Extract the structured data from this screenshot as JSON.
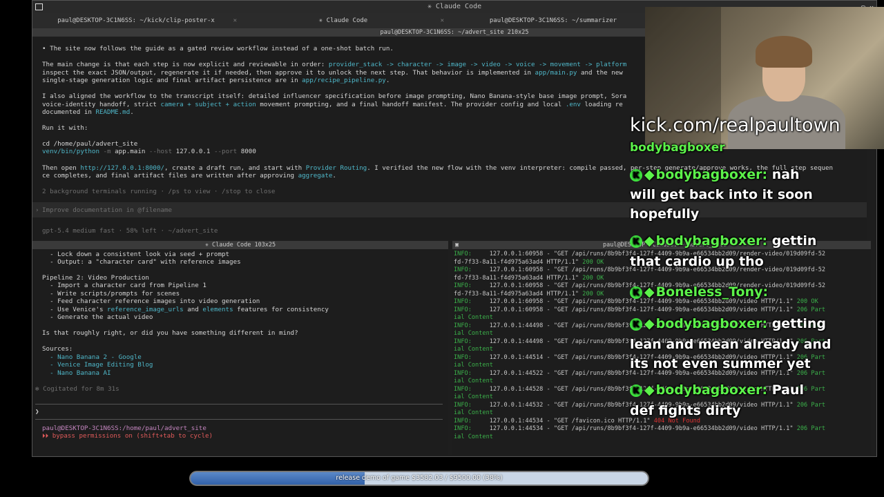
{
  "window": {
    "title": "✳ Claude Code",
    "tabs": [
      {
        "label": "paul@DESKTOP-3C1N6SS: ~/kick/clip-poster-x"
      },
      {
        "label": "✳ Claude Code"
      },
      {
        "label": "paul@DESKTOP-3C1N6SS: ~/summarizer"
      }
    ]
  },
  "top_pane": {
    "header": "paul@DESKTOP-3C1N6SS: ~/advert_site 210x25",
    "lines": {
      "l1": "• The site now follows the guide as a gated review workflow instead of a one-shot batch run.",
      "l2a": "The main change is that each step is now explicit and reviewable in order: ",
      "l2b": "provider_stack -> character -> image -> video -> voice -> movement -> platform",
      "l3a": "inspect the exact JSON/output, regenerate it if needed, then approve it to unlock the next step. That behavior is implemented in ",
      "l3b": "app/main.py",
      "l3c": " and the new",
      "l4a": "single-stage generation logic and final artifact persistence are in ",
      "l4b": "app/recipe_pipeline.py",
      "l4c": ".",
      "l5": "I also aligned the workflow to the transcript itself: detailed influencer specification before image prompting, Nano Banana-style base image prompt, Sora",
      "l6a": "voice-identity handoff, strict ",
      "l6b": "camera + subject + action",
      "l6c": " movement prompting, and a final handoff manifest. The provider config and local ",
      "l6d": ".env",
      "l6e": " loading re",
      "l7a": "documented in ",
      "l7b": "README.md",
      "l7c": ".",
      "l8": "Run it with:",
      "l9": "cd /home/paul/advert_site",
      "l10a": "venv/bin/python",
      "l10b": " -m ",
      "l10c": "app.main",
      "l10d": " --host ",
      "l10e": "127.0.0.1",
      "l10f": " --port ",
      "l10g": "8000",
      "l11a": "Then open ",
      "l11b": "http://127.0.0.1:8000/",
      "l11c": ", create a draft run, and start with ",
      "l11d": "Provider Routing",
      "l11e": ". I verified the new flow with the venv interpreter: compile passed, per-step generate/approve works, the full step sequen",
      "l12a": "ce completes, and final artifact files are written after approving ",
      "l12b": "aggregate",
      "l12c": ".",
      "l13": "2 background terminals running · /ps to view · /stop to close",
      "prompt_placeholder": "Improve documentation in @filename",
      "status": "gpt-5.4 medium fast · 58% left · ~/advert_site"
    }
  },
  "bottom_left": {
    "header": "✳ Claude Code 103x25",
    "lines": [
      "  - Lock down a consistent look via seed + prompt",
      "  - Output: a \"character card\" with reference images",
      "",
      "Pipeline 2: Video Production",
      "  - Import a character card from Pipeline 1",
      "  - Write scripts/prompts for scenes",
      "  - Feed character reference images into video generation",
      "  - Generate the actual video",
      "",
      "Is that roughly right, or did you have something different in mind?",
      "",
      "Sources:"
    ],
    "venice_prefix": "  - Use Venice's ",
    "venice_a": "reference_image_urls",
    "venice_mid": " and ",
    "venice_b": "elements",
    "venice_suffix": " features for consistency",
    "sources": [
      "  - Nano Banana 2 - Google",
      "  - Venice Image Editing Blog",
      "  - Nano Banana AI"
    ],
    "cogitated": "✻ Cogitated for 8m 31s",
    "prompt_symbol": "❯",
    "shell_prompt": "paul@DESKTOP-3C1N6SS:/home/paul/advert_site",
    "bypass": "⏵⏵ bypass permissions on (shift+tab to cycle)"
  },
  "bottom_right": {
    "header": "paul@DESKTOP-3C1N6SS: ~/advert_site",
    "logs": [
      {
        "lvl": "INFO:",
        "body": "     127.0.0.1:60958 - \"GET /api/runs/8b9bf3f4-127f-4409-9b9a-e66534bb2d09/render-video/019d09fd-52"
      },
      {
        "lvl": "",
        "body": "fd-7f33-8a11-f4d975a63ad4 HTTP/1.1\" ",
        "ok": "200 OK"
      },
      {
        "lvl": "INFO:",
        "body": "     127.0.0.1:60958 - \"GET /api/runs/8b9bf3f4-127f-4409-9b9a-e66534bb2d09/render-video/019d09fd-52"
      },
      {
        "lvl": "",
        "body": "fd-7f33-8a11-f4d975a63ad4 HTTP/1.1\" ",
        "ok": "200 OK"
      },
      {
        "lvl": "INFO:",
        "body": "     127.0.0.1:60958 - \"GET /api/runs/8b9bf3f4-127f-4409-9b9a-e66534bb2d09/render-video/019d09fd-52"
      },
      {
        "lvl": "",
        "body": "fd-7f33-8a11-f4d975a63ad4 HTTP/1.1\" ",
        "ok": "200 OK"
      },
      {
        "lvl": "INFO:",
        "body": "     127.0.0.1:60958 - \"GET /api/runs/8b9bf3f4-127f-4409-9b9a-e66534bb2d09/video HTTP/1.1\" ",
        "ok": "200 OK"
      },
      {
        "lvl": "INFO:",
        "body": "     127.0.0.1:60958 - \"GET /api/runs/8b9bf3f4-127f-4409-9b9a-e66534bb2d09/video HTTP/1.1\" ",
        "ok": "206 Part"
      },
      {
        "lvl": "",
        "body": "",
        "ok": "ial Content"
      },
      {
        "lvl": "INFO:",
        "body": "     127.0.0.1:44498 - \"GET /api/runs/8b9bf3f4-127f-4409-9b9a-e66534bb2d09/video HTTP/1.1\" ",
        "ok": "206 Part"
      },
      {
        "lvl": "",
        "body": "",
        "ok": "ial Content"
      },
      {
        "lvl": "INFO:",
        "body": "     127.0.0.1:44498 - \"GET /api/runs/8b9bf3f4-127f-4409-9b9a-e66534bb2d09/video HTTP/1.1\" ",
        "ok": "206 Part"
      },
      {
        "lvl": "",
        "body": "",
        "ok": "ial Content"
      },
      {
        "lvl": "INFO:",
        "body": "     127.0.0.1:44514 - \"GET /api/runs/8b9bf3f4-127f-4409-9b9a-e66534bb2d09/video HTTP/1.1\" ",
        "ok": "206 Part"
      },
      {
        "lvl": "",
        "body": "",
        "ok": "ial Content"
      },
      {
        "lvl": "INFO:",
        "body": "     127.0.0.1:44522 - \"GET /api/runs/8b9bf3f4-127f-4409-9b9a-e66534bb2d09/video HTTP/1.1\" ",
        "ok": "206 Part"
      },
      {
        "lvl": "",
        "body": "",
        "ok": "ial Content"
      },
      {
        "lvl": "INFO:",
        "body": "     127.0.0.1:44528 - \"GET /api/runs/8b9bf3f4-127f-4409-9b9a-e66534bb2d09/video HTTP/1.1\" ",
        "ok": "206 Part"
      },
      {
        "lvl": "",
        "body": "",
        "ok": "ial Content"
      },
      {
        "lvl": "INFO:",
        "body": "     127.0.0.1:44532 - \"GET /api/runs/8b9bf3f4-127f-4409-9b9a-e66534bb2d09/video HTTP/1.1\" ",
        "ok": "206 Part"
      },
      {
        "lvl": "",
        "body": "",
        "ok": "ial Content"
      },
      {
        "lvl": "INFO:",
        "body": "     127.0.0.1:44534 - \"GET /favicon.ico HTTP/1.1\" ",
        "red": "404 Not Found"
      },
      {
        "lvl": "INFO:",
        "body": "     127.0.0.1:44534 - \"GET /api/runs/8b9bf3f4-127f-4409-9b9a-e66534bb2d09/video HTTP/1.1\" ",
        "ok": "206 Part"
      },
      {
        "lvl": "",
        "body": "",
        "ok": "ial Content"
      }
    ]
  },
  "overlay": {
    "kick_url": "kick.com/realpaultown",
    "chat": [
      {
        "user": "bodybagboxer",
        "msg": ""
      },
      {
        "user": "bodybagboxer:",
        "msg": "nah",
        "cont": [
          "will get back into it soon",
          "hopefully"
        ]
      },
      {
        "user": "bodybagboxer:",
        "msg": "gettin",
        "cont": [
          "that cardio up tho"
        ]
      },
      {
        "user": "Boneless_Tony:",
        "msg": "",
        "cont": []
      },
      {
        "user": "bodybagboxer:",
        "msg": "getting",
        "cont": [
          "lean and mean already and",
          "its not even summer yet"
        ]
      },
      {
        "user": "bodybagboxer:",
        "msg": "Paul",
        "cont": [
          "def fights dirty"
        ]
      }
    ]
  },
  "progress": {
    "label": "release demo of game $3582.03 / $9500.00 (38%)",
    "fraction": 0.38
  }
}
